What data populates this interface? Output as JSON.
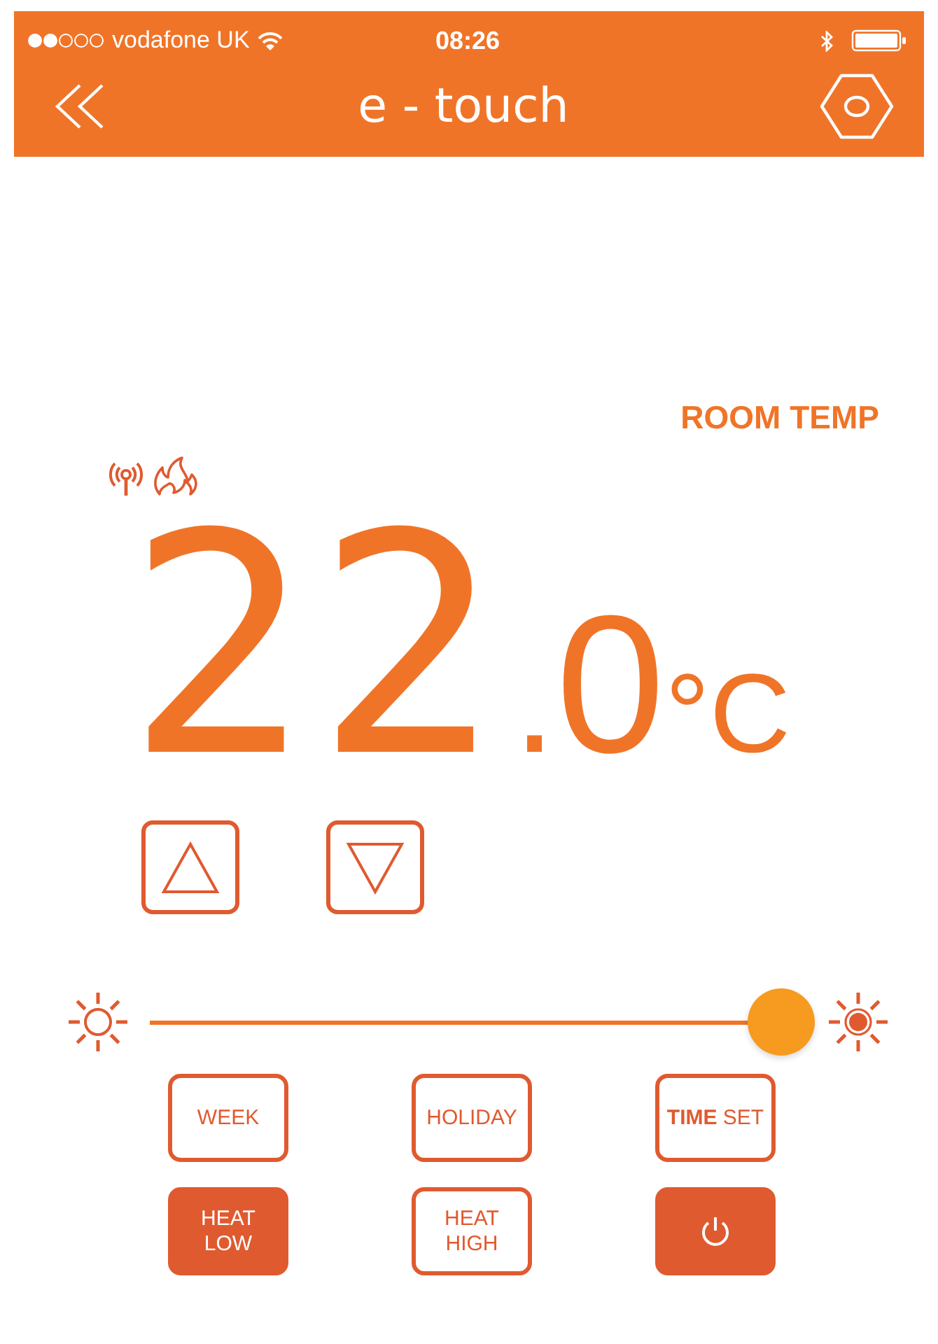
{
  "status_bar": {
    "carrier": "vodafone UK",
    "time": "08:26"
  },
  "header": {
    "title": "e - touch"
  },
  "room_temp": {
    "label": "ROOM TEMP",
    "integer": "22",
    "decimal_point": ".",
    "fraction": "0",
    "unit": "°C"
  },
  "brightness_slider": {
    "level": 1
  },
  "buttons": [
    {
      "kind": "text",
      "label": "WEEK",
      "selected": false
    },
    {
      "kind": "text",
      "label": "HOLIDAY",
      "selected": false
    },
    {
      "kind": "text",
      "label": "**TIME** SET",
      "selected": false
    },
    {
      "kind": "text",
      "label": "HEAT\nLOW",
      "selected": true
    },
    {
      "kind": "text",
      "label": "HEAT\nHIGH",
      "selected": false
    },
    {
      "kind": "power",
      "selected": true
    }
  ]
}
